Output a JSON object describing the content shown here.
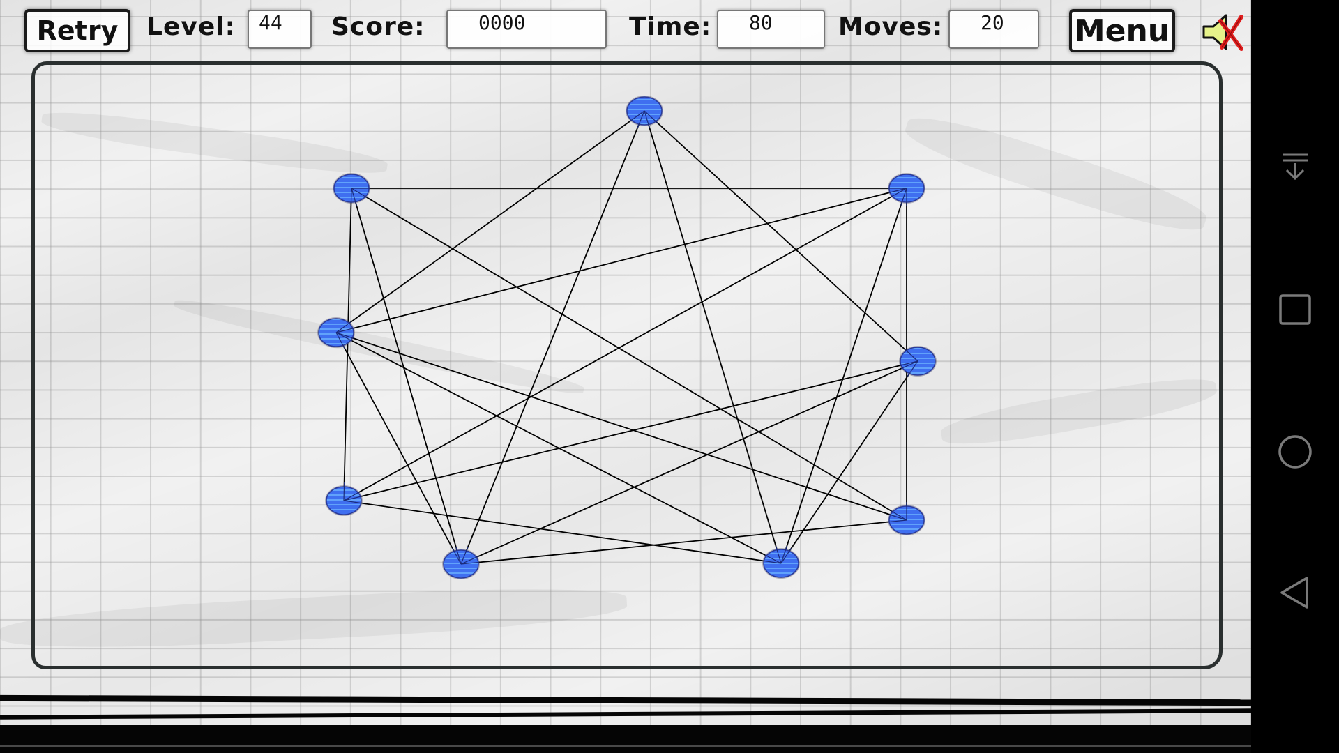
{
  "hud": {
    "retry_label": "Retry",
    "level_label": "Level:",
    "level_value": "44",
    "score_label": "Score:",
    "score_value": "0000",
    "time_label": "Time:",
    "time_value": "80",
    "moves_label": "Moves:",
    "moves_value": "20",
    "menu_label": "Menu",
    "sound_icon": "speaker-muted-icon"
  },
  "colors": {
    "node_fill": "#3f6ff0",
    "node_stripe": "#6fb8ff",
    "node_edge": "#2a3a9a",
    "edge_line": "#000000",
    "frame": "#2a2f2f",
    "speaker_fill": "#e6f28a",
    "mute_x": "#e01e1e"
  },
  "puzzle": {
    "nodes": [
      {
        "id": "A",
        "name": "top"
      },
      {
        "id": "B",
        "name": "upper-left"
      },
      {
        "id": "C",
        "name": "upper-right"
      },
      {
        "id": "D",
        "name": "mid-left"
      },
      {
        "id": "E",
        "name": "mid-right"
      },
      {
        "id": "F",
        "name": "lower-left"
      },
      {
        "id": "G",
        "name": "lower-right"
      },
      {
        "id": "H",
        "name": "bottom-left"
      },
      {
        "id": "I",
        "name": "bottom-right"
      }
    ],
    "edges": [
      [
        "A",
        "D"
      ],
      [
        "A",
        "H"
      ],
      [
        "A",
        "I"
      ],
      [
        "A",
        "E"
      ],
      [
        "B",
        "C"
      ],
      [
        "B",
        "F"
      ],
      [
        "B",
        "H"
      ],
      [
        "B",
        "G"
      ],
      [
        "C",
        "D"
      ],
      [
        "C",
        "F"
      ],
      [
        "C",
        "G"
      ],
      [
        "C",
        "I"
      ],
      [
        "D",
        "H"
      ],
      [
        "D",
        "I"
      ],
      [
        "D",
        "G"
      ],
      [
        "F",
        "E"
      ],
      [
        "F",
        "I"
      ],
      [
        "H",
        "E"
      ],
      [
        "H",
        "G"
      ],
      [
        "I",
        "E"
      ]
    ]
  },
  "navbar": {
    "icons": [
      "collapse-icon",
      "recents-icon",
      "home-icon",
      "back-icon"
    ]
  }
}
